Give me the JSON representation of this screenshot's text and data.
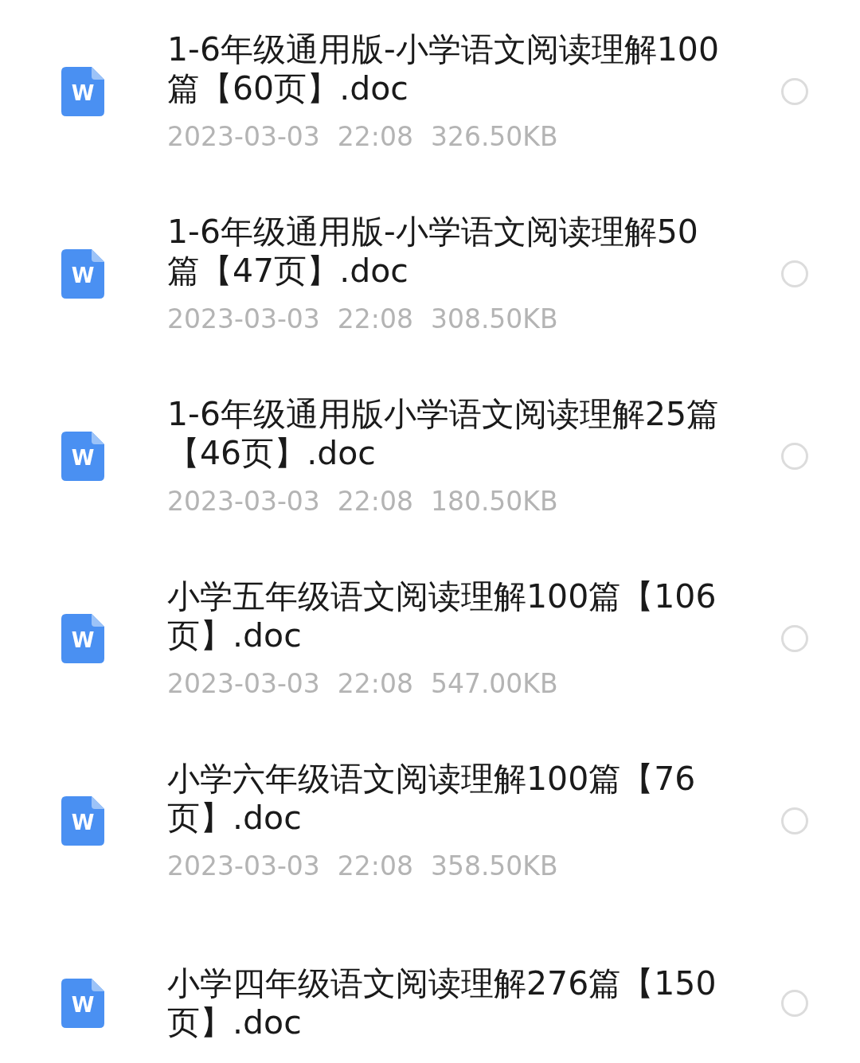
{
  "files": [
    {
      "icon_label": "W",
      "name": "1-6年级通用版-小学语文阅读理解100篇【60页】.doc",
      "date": "2023-03-03",
      "time": "22:08",
      "size": "326.50KB",
      "selected": false
    },
    {
      "icon_label": "W",
      "name": "1-6年级通用版-小学语文阅读理解50篇【47页】.doc",
      "date": "2023-03-03",
      "time": "22:08",
      "size": "308.50KB",
      "selected": false
    },
    {
      "icon_label": "W",
      "name": "1-6年级通用版小学语文阅读理解25篇【46页】.doc",
      "date": "2023-03-03",
      "time": "22:08",
      "size": "180.50KB",
      "selected": false
    },
    {
      "icon_label": "W",
      "name": "小学五年级语文阅读理解100篇【106页】.doc",
      "date": "2023-03-03",
      "time": "22:08",
      "size": "547.00KB",
      "selected": false
    },
    {
      "icon_label": "W",
      "name": "小学六年级语文阅读理解100篇【76页】.doc",
      "date": "2023-03-03",
      "time": "22:08",
      "size": "358.50KB",
      "selected": false
    },
    {
      "icon_label": "W",
      "name": "小学四年级语文阅读理解276篇【150页】.doc",
      "selected": false
    }
  ]
}
